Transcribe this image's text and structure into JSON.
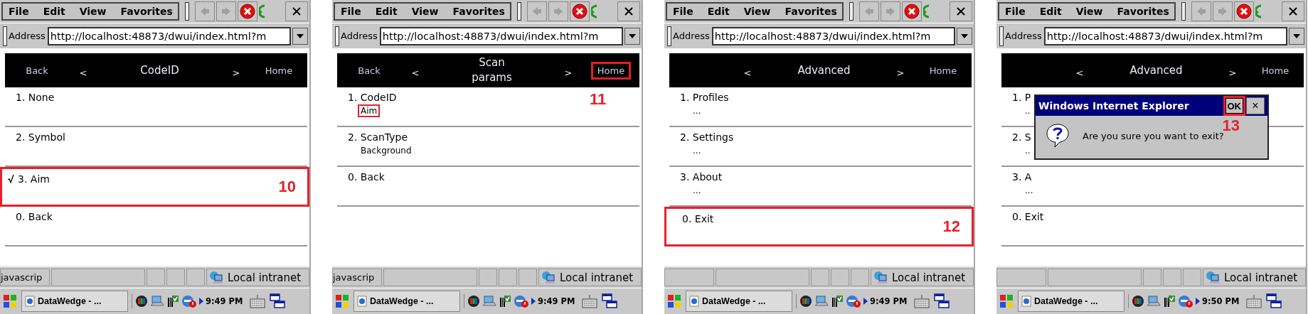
{
  "panels": [
    {
      "menu": [
        "File",
        "Edit",
        "View",
        "Favorites"
      ],
      "address_label": "Address",
      "url": "http://localhost:48873/dwui/index.html?m",
      "nav": {
        "back": "Back",
        "prev": "<",
        "title": "CodeID",
        "next": ">",
        "home": {
          "text": "Home",
          "boxed": false
        }
      },
      "items": [
        {
          "label": "1. None",
          "checked": false,
          "boxed": false
        },
        {
          "label": "2. Symbol",
          "checked": false,
          "boxed": false
        },
        {
          "label": "3. Aim",
          "checked": true,
          "boxed": true,
          "callout": "10"
        },
        {
          "label": "0. Back",
          "checked": false,
          "boxed": false
        }
      ],
      "status": "javascrip",
      "zone": "Local intranet",
      "task": "DataWedge - ...",
      "time": "9:49 PM"
    },
    {
      "menu": [
        "File",
        "Edit",
        "View",
        "Favorites"
      ],
      "address_label": "Address",
      "url": "http://localhost:48873/dwui/index.html?m",
      "nav": {
        "back": "Back",
        "prev": "<",
        "title": "Scan params",
        "next": ">",
        "home": {
          "text": "Home",
          "boxed": true,
          "callout": "11"
        }
      },
      "items": [
        {
          "label": "1. CodeID",
          "sub": {
            "text": "Aim",
            "boxed": true
          },
          "boxed": false
        },
        {
          "label": "2. ScanType",
          "sub": {
            "text": "Background",
            "boxed": false
          },
          "boxed": false
        },
        {
          "label": "0. Back",
          "boxed": false
        }
      ],
      "status": "javascrip",
      "zone": "Local intranet",
      "task": "DataWedge - ...",
      "time": "9:49 PM"
    },
    {
      "menu": [
        "File",
        "Edit",
        "View",
        "Favorites"
      ],
      "address_label": "Address",
      "url": "http://localhost:48873/dwui/index.html?m",
      "nav": {
        "prev": "<",
        "title": "Advanced",
        "next": ">",
        "home": {
          "text": "Home",
          "boxed": false
        }
      },
      "items": [
        {
          "label": "1. Profiles",
          "sub": {
            "text": "...",
            "boxed": false
          },
          "boxed": false
        },
        {
          "label": "2. Settings",
          "sub": {
            "text": "...",
            "boxed": false
          },
          "boxed": false
        },
        {
          "label": "3. About",
          "sub": {
            "text": "...",
            "boxed": false
          },
          "boxed": false
        },
        {
          "label": "0. Exit",
          "boxed": true,
          "callout": "12"
        }
      ],
      "zone": "Local intranet",
      "task": "DataWedge - ...",
      "time": "9:49 PM"
    },
    {
      "menu": [
        "File",
        "Edit",
        "View",
        "Favorites"
      ],
      "address_label": "Address",
      "url": "http://localhost:48873/dwui/index.html?m",
      "nav": {
        "prev": "<",
        "title": "Advanced",
        "next": ">",
        "home": {
          "text": "Home",
          "boxed": false
        }
      },
      "items": [
        {
          "label": "1. P",
          "sub": {
            "text": "..",
            "boxed": false
          },
          "boxed": false
        },
        {
          "label": "2. S",
          "sub": {
            "text": "..",
            "boxed": false
          },
          "boxed": false
        },
        {
          "label": "3. A",
          "sub": {
            "text": "...",
            "boxed": false
          },
          "boxed": false
        },
        {
          "label": "0. Exit",
          "boxed": false
        }
      ],
      "dialog": {
        "title": "Windows Internet Explorer",
        "ok": {
          "text": "OK",
          "boxed": true,
          "callout": "13"
        },
        "close": "×",
        "message": "Are you sure you want to exit?"
      },
      "zone": "Local intranet",
      "task": "DataWedge - ...",
      "time": "9:50 PM"
    }
  ]
}
